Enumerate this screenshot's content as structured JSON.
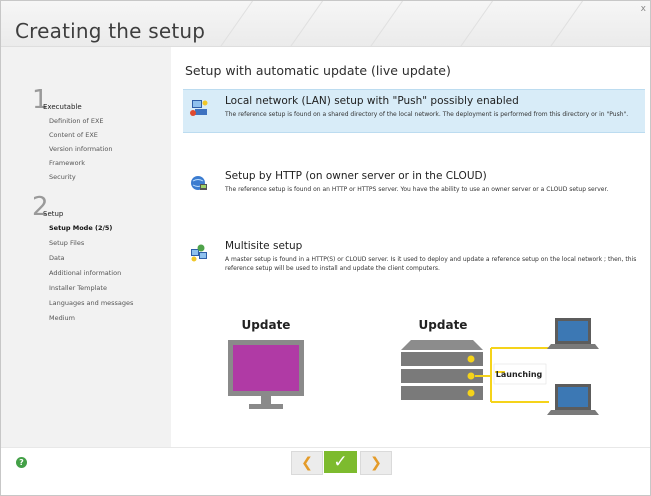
{
  "window": {
    "title": "Creating the setup",
    "close_label": "x"
  },
  "sidebar": {
    "steps": [
      {
        "number": "1",
        "name": "Executable",
        "items": [
          "Definition of EXE",
          "Content of EXE",
          "Version information",
          "Framework",
          "Security"
        ]
      },
      {
        "number": "2",
        "name": "Setup",
        "items": [
          "Setup Mode (2/5)",
          "Setup Files",
          "Data",
          "Additional information",
          "Installer Template",
          "Languages and messages",
          "Medium"
        ]
      }
    ],
    "active_item": "Setup Mode (2/5)"
  },
  "main": {
    "heading": "Setup with automatic update (live update)",
    "options": [
      {
        "title": "Local network (LAN) setup with \"Push\" possibly enabled",
        "description": "The reference setup is found on a shared directory of the local network. The deployment is performed from this directory or in \"Push\".",
        "selected": true,
        "icon": "lan-setup-icon"
      },
      {
        "title": "Setup by HTTP (on owner server or in the CLOUD)",
        "description": "The reference setup is found on an HTTP or HTTPS server. You have the ability to use an owner server or a CLOUD setup server.",
        "selected": false,
        "icon": "http-setup-icon"
      },
      {
        "title": "Multisite setup",
        "description": "A master setup is found in a HTTP(S) or CLOUD server. Is it used to deploy and update a reference setup on the local network ; then, this reference setup will be used to install and update the client computers.",
        "selected": false,
        "icon": "multisite-setup-icon"
      }
    ],
    "illustration": {
      "left_label": "Update",
      "right_label": "Update",
      "connector_label": "Launching",
      "colors": {
        "monitor_screen": "#b03aa5",
        "server": "#7a7a7a",
        "accent": "#f5d31a",
        "client_screen": "#3c78b4"
      }
    }
  },
  "footer": {
    "help_label": "?",
    "back_label": "❮",
    "ok_label": "✓",
    "next_label": "❯"
  }
}
